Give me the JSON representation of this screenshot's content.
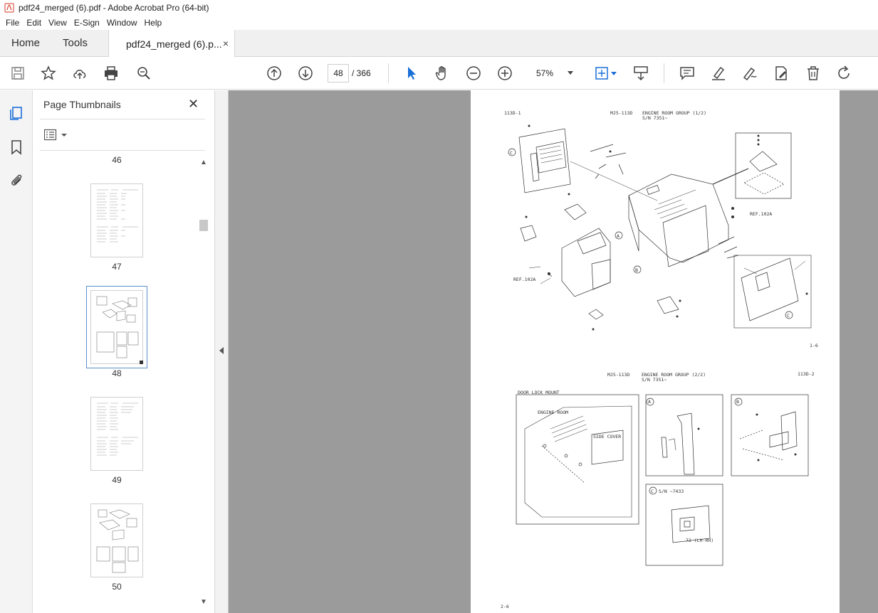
{
  "window": {
    "title": "pdf24_merged (6).pdf - Adobe Acrobat Pro (64-bit)"
  },
  "menu": {
    "items": [
      "File",
      "Edit",
      "View",
      "E-Sign",
      "Window",
      "Help"
    ]
  },
  "tabs": {
    "home": "Home",
    "tools": "Tools",
    "document": "pdf24_merged (6).p...",
    "close": "×"
  },
  "toolbar": {
    "current_page": "48",
    "total_pages": "/ 366",
    "zoom": "57%"
  },
  "thumbnails": {
    "title": "Page Thumbnails",
    "close": "✕",
    "pages": [
      {
        "label": "46"
      },
      {
        "label": "47"
      },
      {
        "label": "48"
      },
      {
        "label": "49"
      },
      {
        "label": "50"
      }
    ]
  },
  "document_page": {
    "top_code": "113D-1",
    "model_1": "MJ5-113D",
    "group_1": "ENGINE ROOM GROUP (1/2)",
    "serial_1": "S/N 7351~",
    "ref_1": "REF.102A",
    "ref_2": "REF.102A",
    "page_mark_1": "1-6",
    "model_2": "MJ5-113D",
    "group_2": "ENGINE ROOM GROUP (2/2)",
    "serial_2": "S/N 7351~",
    "code_2": "113D-2",
    "door_lock": "DOOR LOCK MOUNT",
    "engine_room": "ENGINE ROOM",
    "side_cover": "SIDE COVER",
    "detail_a": "A",
    "detail_b": "B",
    "detail_c": "C",
    "detail_c_sn": "S/N ~7433",
    "lh_rh": "72 (LH·RH)",
    "bottom_mark": "2-6"
  }
}
